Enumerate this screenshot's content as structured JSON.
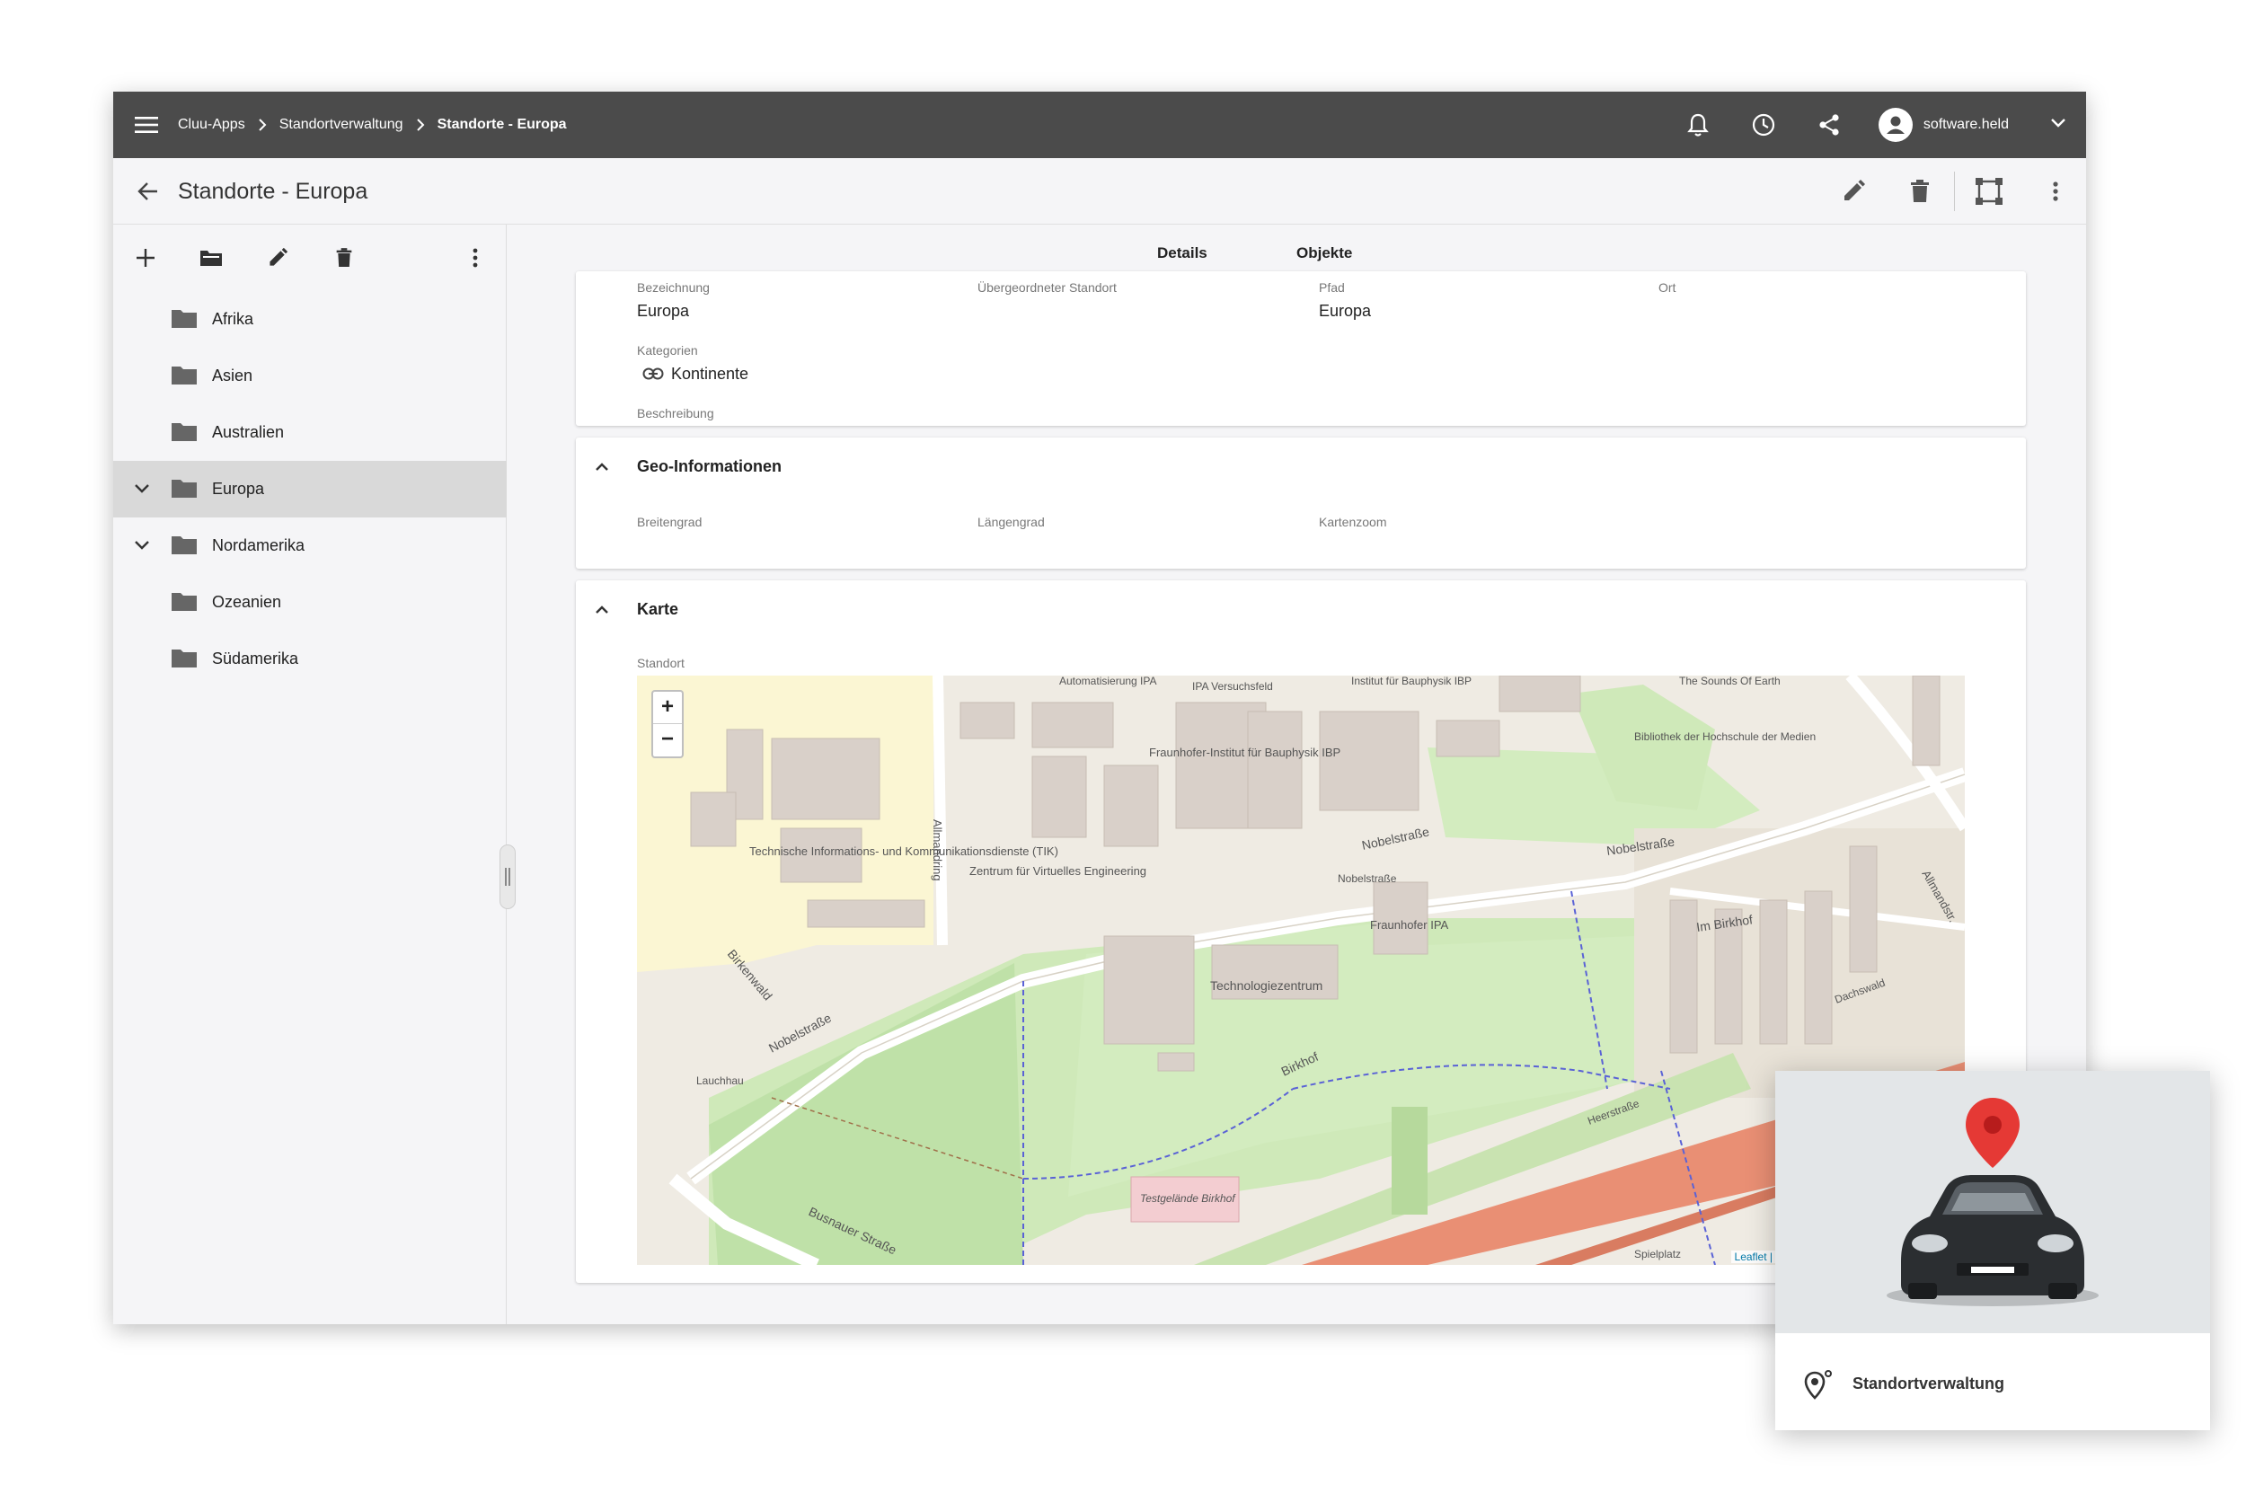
{
  "topbar": {
    "breadcrumb": [
      "Cluu-Apps",
      "Standortverwaltung",
      "Standorte - Europa"
    ],
    "user": "software.held",
    "icons": [
      "menu-icon",
      "bell-icon",
      "clock-icon",
      "share-icon",
      "account-icon",
      "chevron-down-icon"
    ]
  },
  "titlebar": {
    "title": "Standorte - Europa",
    "icons": [
      "arrow-back-icon",
      "pencil-icon",
      "trash-icon",
      "select-frame-icon",
      "more-vert-icon"
    ]
  },
  "sidebar": {
    "toolbar_icons": [
      "plus-icon",
      "folder-open-icon",
      "pencil-icon",
      "trash-icon",
      "more-vert-icon"
    ],
    "items": [
      {
        "label": "Afrika",
        "expanded": false
      },
      {
        "label": "Asien",
        "expanded": false
      },
      {
        "label": "Australien",
        "expanded": false
      },
      {
        "label": "Europa",
        "expanded": true,
        "selected": true
      },
      {
        "label": "Nordamerika",
        "expanded": true
      },
      {
        "label": "Ozeanien",
        "expanded": false
      },
      {
        "label": "Südamerika",
        "expanded": false
      }
    ]
  },
  "tabs": [
    {
      "label": "Details",
      "active": true
    },
    {
      "label": "Objekte",
      "active": false
    }
  ],
  "details": {
    "bezeichnung_label": "Bezeichnung",
    "bezeichnung_value": "Europa",
    "uebergeordnet_label": "Übergeordneter Standort",
    "pfad_label": "Pfad",
    "pfad_value": "Europa",
    "ort_label": "Ort",
    "kategorien_label": "Kategorien",
    "kategorie_value": "Kontinente",
    "beschreibung_label": "Beschreibung"
  },
  "geo": {
    "title": "Geo-Informationen",
    "breitengrad_label": "Breitengrad",
    "laengengrad_label": "Längengrad",
    "kartenzoom_label": "Kartenzoom"
  },
  "karte": {
    "title": "Karte",
    "standort_label": "Standort",
    "zoom_in": "+",
    "zoom_out": "−",
    "attribution": "Leaflet |",
    "labels": {
      "nobelstrasse": "Nobelstraße",
      "birkenwald": "Birkenwald",
      "busnauer": "Busnauer Straße",
      "birkhof": "Birkhof",
      "im_birkhof": "Im Birkhof",
      "allmandring": "Allmandring",
      "technologiezentrum": "Technologiezentrum",
      "tik": "Technische Informations- und Kommunikationsdienste (TIK)",
      "zentrum": "Zentrum für Virtuelles Engineering",
      "ibp": "Fraunhofer-Institut für Bauphysik IBP",
      "ipa": "Fraunhofer IPA",
      "bibliothek": "Bibliothek der Hochschule der Medien",
      "testgelaende": "Testgelände Birkhof",
      "spielplatz": "Spielplatz",
      "lauchhau": "Lauchhau",
      "sounds": "The Sounds Of Earth",
      "automatisierung": "Automatisierung IPA",
      "versuchsfeld": "IPA Versuchsfeld",
      "institut_ibp": "Institut für Bauphysik IBP",
      "heerstrasse": "Heerstraße",
      "dachswald": "Dachswald",
      "nobelstrasse_stop": "Nobelstraße",
      "allmand": "Allmandstr."
    }
  },
  "tile": {
    "label": "Standortverwaltung",
    "icons": [
      "map-pin-icon",
      "car-image",
      "location-settings-icon"
    ]
  },
  "colors": {
    "topbar": "#4b4b4b",
    "accent": "#f5a623",
    "selected": "#d9d9d9",
    "pin": "#e53935"
  }
}
